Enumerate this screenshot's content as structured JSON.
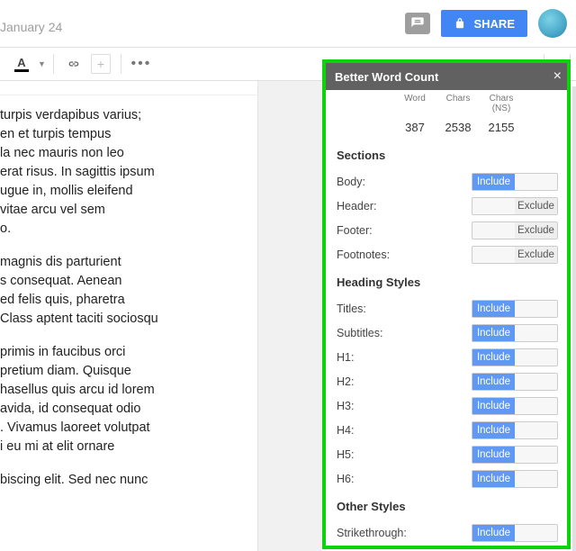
{
  "header": {
    "date_text": "January 24",
    "share_label": "SHARE"
  },
  "document": {
    "p1": "turpis verdapibus varius;\nen et turpis tempus\nla nec mauris non leo\nerat risus. In sagittis ipsum\nugue in, mollis eleifend\nvitae arcu vel sem\no.",
    "p2": "magnis dis parturient\ns consequat. Aenean\ned felis quis, pharetra\nClass aptent taciti sociosqu",
    "p3": "primis in faucibus orci\npretium diam. Quisque\nhasellus quis arcu id lorem\navida, id consequat odio\n. Vivamus laoreet volutpat\ni eu mi at elit ornare",
    "p4": "biscing elit. Sed nec nunc"
  },
  "panel": {
    "title": "Better Word Count",
    "count_headers": {
      "word": "Word",
      "chars": "Chars",
      "chars_ns": "Chars (NS)"
    },
    "counts": {
      "word": "387",
      "chars": "2538",
      "chars_ns": "2155"
    },
    "labels": {
      "include": "Include",
      "exclude": "Exclude"
    },
    "sections_title": "Sections",
    "sections": {
      "body": "Body:",
      "header": "Header:",
      "footer": "Footer:",
      "footnotes": "Footnotes:"
    },
    "heading_title": "Heading Styles",
    "headings": {
      "titles": "Titles:",
      "subtitles": "Subtitles:",
      "h1": "H1:",
      "h2": "H2:",
      "h3": "H3:",
      "h4": "H4:",
      "h5": "H5:",
      "h6": "H6:"
    },
    "other_title": "Other Styles",
    "other": {
      "strikethrough": "Strikethrough:"
    }
  }
}
